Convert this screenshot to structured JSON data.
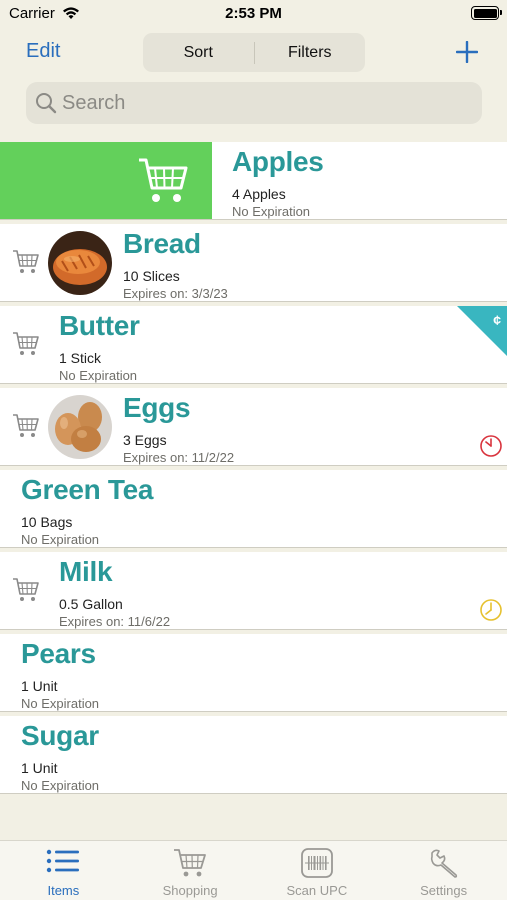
{
  "status": {
    "carrier": "Carrier",
    "time": "2:53 PM"
  },
  "nav": {
    "edit_label": "Edit",
    "sort_label": "Sort",
    "filters_label": "Filters"
  },
  "search": {
    "placeholder": "Search",
    "value": ""
  },
  "items": [
    {
      "name": "Apples",
      "qty": "4 Apples",
      "expiry": "No Expiration"
    },
    {
      "name": "Bread",
      "qty": "10 Slices",
      "expiry": "Expires on: 3/3/23"
    },
    {
      "name": "Butter",
      "qty": "1 Stick",
      "expiry": "No Expiration",
      "badge": "¢"
    },
    {
      "name": "Eggs",
      "qty": "3 Eggs",
      "expiry": "Expires on: 11/2/22"
    },
    {
      "name": "Green Tea",
      "qty": "10 Bags",
      "expiry": "No Expiration"
    },
    {
      "name": "Milk",
      "qty": "0.5 Gallon",
      "expiry": "Expires on: 11/6/22"
    },
    {
      "name": "Pears",
      "qty": "1 Unit",
      "expiry": "No Expiration"
    },
    {
      "name": "Sugar",
      "qty": "1 Unit",
      "expiry": "No Expiration"
    }
  ],
  "tabs": [
    {
      "label": "Items",
      "icon": "list-icon",
      "active": true
    },
    {
      "label": "Shopping",
      "icon": "cart-icon"
    },
    {
      "label": "Scan UPC",
      "icon": "barcode-icon"
    },
    {
      "label": "Settings",
      "icon": "wrench-icon"
    }
  ],
  "colors": {
    "accent": "#2a6ebd",
    "item_name": "#2a9898",
    "swipe_green": "#63d05b",
    "badge_teal": "#39b6c0",
    "expired_red": "#d9343e",
    "expiring_yellow": "#e6c12f"
  }
}
